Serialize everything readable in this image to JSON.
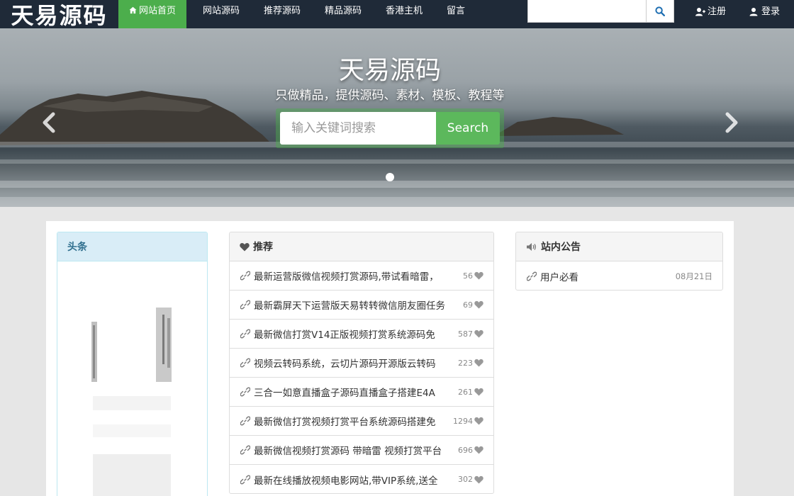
{
  "site": {
    "logo": "天易源码"
  },
  "nav": {
    "items": [
      {
        "label": "网站首页",
        "active": true
      },
      {
        "label": "网站源码"
      },
      {
        "label": "推荐源码"
      },
      {
        "label": "精品源码"
      },
      {
        "label": "香港主机"
      },
      {
        "label": "留言"
      }
    ],
    "search_value": "",
    "register_label": "注册",
    "login_label": "登录"
  },
  "hero": {
    "title": "天易源码",
    "subtitle": "只做精品，提供源码、素材、模板、教程等",
    "search_placeholder": "输入关键词搜索",
    "search_button": "Search"
  },
  "headline": {
    "title": "头条"
  },
  "recommend": {
    "title": "推荐",
    "items": [
      {
        "title": "最新运营版微信视频打赏源码,带试看暗雷，",
        "count": "56"
      },
      {
        "title": "最新霸屏天下运营版天易转转微信朋友圈任务",
        "count": "69"
      },
      {
        "title": "最新微信打赏V14正版视频打赏系统源码免",
        "count": "587"
      },
      {
        "title": "视频云转码系统，云切片源码开源版云转码",
        "count": "223"
      },
      {
        "title": "三合一如意直播盒子源码直播盒子搭建E4A",
        "count": "261"
      },
      {
        "title": "最新微信打赏视频打赏平台系统源码搭建免",
        "count": "1294"
      },
      {
        "title": "最新微信视频打赏源码 带暗雷 视频打赏平台",
        "count": "696"
      },
      {
        "title": "最新在线播放视频电影网站,带VIP系统,送全",
        "count": "302"
      }
    ]
  },
  "notice": {
    "title": "站内公告",
    "items": [
      {
        "title": "用户必看",
        "date": "08月21日"
      }
    ]
  },
  "colors": {
    "navbar": "#1f2a38",
    "accent": "#4cae4c",
    "button": "#5cb85c"
  },
  "icons": [
    "home-icon",
    "search-icon",
    "user-add-icon",
    "user-icon",
    "heart-icon",
    "volume-icon",
    "link-icon",
    "chevron-left-icon",
    "chevron-right-icon"
  ]
}
